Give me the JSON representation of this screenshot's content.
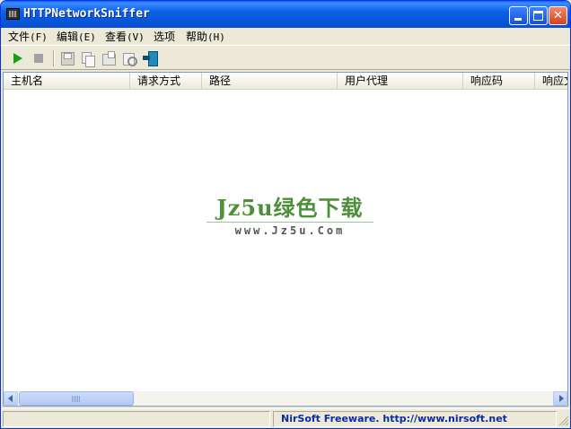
{
  "window": {
    "title": "HTTPNetworkSniffer",
    "icon": "app-icon",
    "controls": [
      "minimize-icon",
      "maximize-icon",
      "close-icon"
    ]
  },
  "menu": {
    "items": [
      {
        "label": "文件",
        "accel": "(F)"
      },
      {
        "label": "编辑",
        "accel": "(E)"
      },
      {
        "label": "查看",
        "accel": "(V)"
      },
      {
        "label": "选项",
        "accel": ""
      },
      {
        "label": "帮助",
        "accel": "(H)"
      }
    ]
  },
  "toolbar": {
    "icons": [
      "play-icon",
      "stop-icon",
      "save-icon",
      "copy-icon",
      "properties-icon",
      "find-icon",
      "exit-icon"
    ]
  },
  "list": {
    "columns": [
      "主机名",
      "请求方式",
      "路径",
      "用户代理",
      "响应码",
      "响应文"
    ]
  },
  "watermark": {
    "main": "Jz5u绿色下载",
    "sub": "www.Jz5u.Com"
  },
  "status": {
    "left": "",
    "right": "NirSoft Freeware.  http://www.nirsoft.net"
  },
  "colors": {
    "titlebar": "#0A5FFF",
    "status_text": "#0A2AA8",
    "watermark_green": "#4E8F3A"
  }
}
